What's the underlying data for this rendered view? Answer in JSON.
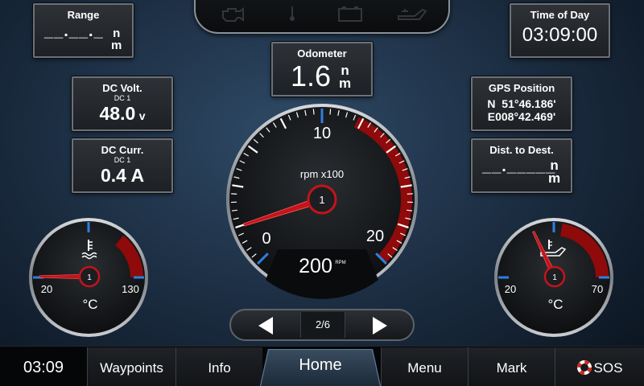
{
  "tiles": {
    "range": {
      "label": "Range",
      "value": "__.__._",
      "unit_top": "n",
      "unit_bottom": "m"
    },
    "time_of_day": {
      "label": "Time of Day",
      "value": "03:09:00"
    },
    "odometer": {
      "label": "Odometer",
      "value": "1.6",
      "unit_top": "n",
      "unit_bottom": "m"
    },
    "dc_volt": {
      "label": "DC Volt.",
      "source": "DC 1",
      "value": "48.0",
      "unit": "v"
    },
    "dc_curr": {
      "label": "DC Curr.",
      "source": "DC 1",
      "value": "0.4 A"
    },
    "gps": {
      "label": "GPS Position",
      "lat": "N  51°46.186'",
      "lon": "E008°42.469'"
    },
    "dist_dest": {
      "label": "Dist. to Dest.",
      "value": "__._____",
      "unit_top": "n",
      "unit_bottom": "m"
    }
  },
  "tachometer": {
    "title": "rpm x100",
    "tick_min": "0",
    "tick_mid": "10",
    "tick_max": "20",
    "engine_badge": "1",
    "readout": "200",
    "readout_unit_top": "RPM",
    "min": 0,
    "max": 20,
    "value": 2,
    "redline_start": 12
  },
  "coolant_gauge": {
    "icon": "coolant-temp-icon",
    "min_label": "20",
    "max_label": "130",
    "unit": "°C",
    "engine_badge": "1",
    "min": 20,
    "max": 130,
    "value": 20
  },
  "oil_gauge": {
    "icon": "oil-temp-icon",
    "min_label": "20",
    "max_label": "70",
    "unit": "°C",
    "engine_badge": "1",
    "min": 20,
    "max": 70,
    "value": 38
  },
  "warning_icons": [
    "engine-warning-icon",
    "temperature-warning-icon",
    "battery-warning-icon",
    "oil-pressure-warning-icon"
  ],
  "pager": {
    "label": "2/6"
  },
  "bottom_bar": {
    "clock": "03:09",
    "tabs": [
      "Waypoints",
      "Info",
      "Home",
      "Menu",
      "Mark",
      "SOS"
    ]
  },
  "colors": {
    "redline": "#8f0a0a",
    "needle": "#c3141c",
    "accent_blue": "#2e7fe0",
    "tile_border": "#6b7178"
  }
}
